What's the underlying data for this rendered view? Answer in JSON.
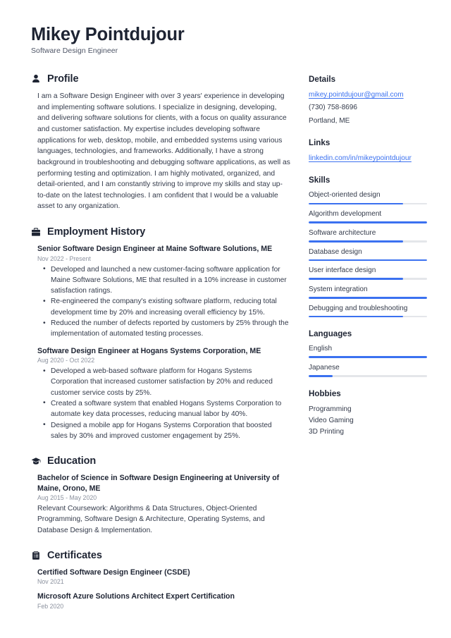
{
  "header": {
    "name": "Mikey Pointdujour",
    "title": "Software Design Engineer"
  },
  "accent_color": "#3b71f0",
  "text_color": "#333a4a",
  "heading_color": "#1e2433",
  "muted_color": "#8b919e",
  "sections": {
    "profile": {
      "icon": "person-icon",
      "title": "Profile",
      "text": "I am a Software Design Engineer with over 3 years' experience in developing and implementing software solutions. I specialize in designing, developing, and delivering software solutions for clients, with a focus on quality assurance and customer satisfaction. My expertise includes developing software applications for web, desktop, mobile, and embedded systems using various languages, technologies, and frameworks. Additionally, I have a strong background in troubleshooting and debugging software applications, as well as performing testing and optimization. I am highly motivated, organized, and detail-oriented, and I am constantly striving to improve my skills and stay up-to-date on the latest technologies. I am confident that I would be a valuable asset to any organization."
    },
    "employment": {
      "icon": "briefcase-icon",
      "title": "Employment History",
      "entries": [
        {
          "title": "Senior Software Design Engineer at Maine Software Solutions, ME",
          "date": "Nov 2022 - Present",
          "bullets": [
            "Developed and launched a new customer-facing software application for Maine Software Solutions, ME that resulted in a 10% increase in customer satisfaction ratings.",
            "Re-engineered the company's existing software platform, reducing total development time by 20% and increasing overall efficiency by 15%.",
            "Reduced the number of defects reported by customers by 25% through the implementation of automated testing processes."
          ]
        },
        {
          "title": "Software Design Engineer at Hogans Systems Corporation, ME",
          "date": "Aug 2020 - Oct 2022",
          "bullets": [
            "Developed a web-based software platform for Hogans Systems Corporation that increased customer satisfaction by 20% and reduced customer service costs by 25%.",
            "Created a software system that enabled Hogans Systems Corporation to automate key data processes, reducing manual labor by 40%.",
            "Designed a mobile app for Hogans Systems Corporation that boosted sales by 30% and improved customer engagement by 25%."
          ]
        }
      ]
    },
    "education": {
      "icon": "graduation-cap-icon",
      "title": "Education",
      "entries": [
        {
          "title": "Bachelor of Science in Software Design Engineering at University of Maine, Orono, ME",
          "date": "Aug 2015 - May 2020",
          "description": "Relevant Coursework: Algorithms & Data Structures, Object-Oriented Programming, Software Design & Architecture, Operating Systems, and Database Design & Implementation."
        }
      ]
    },
    "certificates": {
      "icon": "clipboard-icon",
      "title": "Certificates",
      "entries": [
        {
          "title": "Certified Software Design Engineer (CSDE)",
          "date": "Nov 2021"
        },
        {
          "title": "Microsoft Azure Solutions Architect Expert Certification",
          "date": "Feb 2020"
        }
      ]
    }
  },
  "sidebar": {
    "details": {
      "title": "Details",
      "email": "mikey.pointdujour@gmail.com",
      "phone": "(730) 758-8696",
      "location": "Portland, ME"
    },
    "links": {
      "title": "Links",
      "items": [
        {
          "label": "linkedin.com/in/mikeypointdujour"
        }
      ]
    },
    "skills": {
      "title": "Skills",
      "items": [
        {
          "label": "Object-oriented design",
          "level": 80
        },
        {
          "label": "Algorithm development",
          "level": 100
        },
        {
          "label": "Software architecture",
          "level": 80
        },
        {
          "label": "Database design",
          "level": 100
        },
        {
          "label": "User interface design",
          "level": 80
        },
        {
          "label": "System integration",
          "level": 100
        },
        {
          "label": "Debugging and troubleshooting",
          "level": 80
        }
      ]
    },
    "languages": {
      "title": "Languages",
      "items": [
        {
          "label": "English",
          "level": 100
        },
        {
          "label": "Japanese",
          "level": 20
        }
      ]
    },
    "hobbies": {
      "title": "Hobbies",
      "items": [
        {
          "label": "Programming"
        },
        {
          "label": "Video Gaming"
        },
        {
          "label": "3D Printing"
        }
      ]
    }
  }
}
